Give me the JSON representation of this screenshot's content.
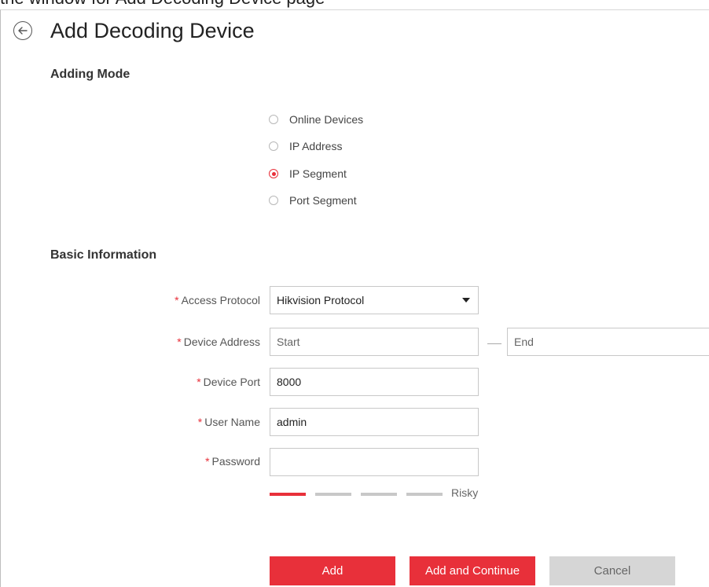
{
  "caption": "the window for Add Decoding Device page",
  "page": {
    "title": "Add Decoding Device"
  },
  "adding_mode": {
    "title": "Adding Mode",
    "options": [
      {
        "label": "Online Devices",
        "checked": false
      },
      {
        "label": "IP Address",
        "checked": false
      },
      {
        "label": "IP Segment",
        "checked": true
      },
      {
        "label": "Port Segment",
        "checked": false
      }
    ]
  },
  "basic_info": {
    "title": "Basic Information",
    "required_mark": "*",
    "access_protocol": {
      "label": "Access Protocol",
      "value": "Hikvision Protocol"
    },
    "device_address": {
      "label": "Device Address",
      "start_placeholder": "Start",
      "end_placeholder": "End"
    },
    "device_port": {
      "label": "Device Port",
      "value": "8000"
    },
    "user_name": {
      "label": "User Name",
      "value": "admin"
    },
    "password": {
      "label": "Password",
      "value": ""
    },
    "strength": {
      "label": "Risky",
      "level": 1,
      "max_level": 4,
      "active_color": "#e8303a",
      "inactive_color": "#c8c8c8"
    }
  },
  "buttons": {
    "add": "Add",
    "add_continue": "Add and Continue",
    "cancel": "Cancel"
  },
  "colors": {
    "accent": "#e8303a"
  }
}
